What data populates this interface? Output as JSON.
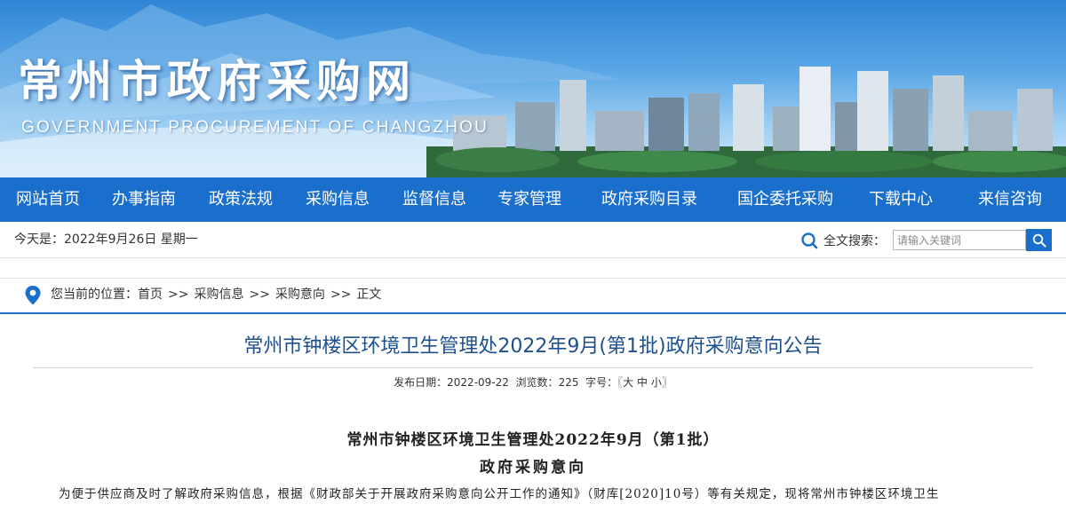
{
  "banner": {
    "title": "常州市政府采购网",
    "subtitle": "GOVERNMENT PROCUREMENT OF CHANGZHOU"
  },
  "nav": {
    "items": [
      {
        "label": "网站首页"
      },
      {
        "label": "办事指南"
      },
      {
        "label": "政策法规"
      },
      {
        "label": "采购信息"
      },
      {
        "label": "监督信息"
      },
      {
        "label": "专家管理"
      },
      {
        "label": "政府采购目录"
      },
      {
        "label": "国企委托采购"
      },
      {
        "label": "下载中心"
      },
      {
        "label": "来信咨询"
      }
    ]
  },
  "infobar": {
    "today": "今天是：2022年9月26日 星期一",
    "search_label": "全文搜索：",
    "search_placeholder": "请输入关键词",
    "search_icon": "search-icon"
  },
  "breadcrumb": {
    "prefix": "您当前的位置：",
    "items": [
      "首页",
      "采购信息",
      "采购意向",
      "正文"
    ],
    "separator": ">>"
  },
  "article": {
    "title": "常州市钟楼区环境卫生管理处2022年9月(第1批)政府采购意向公告",
    "meta": {
      "date_label": "发布日期：",
      "date": "2022-09-22",
      "views_label": "浏览数：",
      "views": "225",
      "fontsize_label": "字号：",
      "fontsize_open": "〖",
      "fontsize_large": "大",
      "fontsize_medium": "中",
      "fontsize_small": "小",
      "fontsize_close": "〗"
    },
    "doc_heading_1": "常州市钟楼区环境卫生管理处2022年9月（第1批）",
    "doc_heading_2": "政府采购意向",
    "body_text": "为便于供应商及时了解政府采购信息，根据《财政部关于开展政府采购意向公开工作的通知》（财库[2020]10号）等有关规定，现将常州市钟楼区环境卫生"
  },
  "colors": {
    "nav_bg": "#1b6fcc",
    "title_blue": "#1e4f8f",
    "banner_sky": "#5aa6e6"
  }
}
